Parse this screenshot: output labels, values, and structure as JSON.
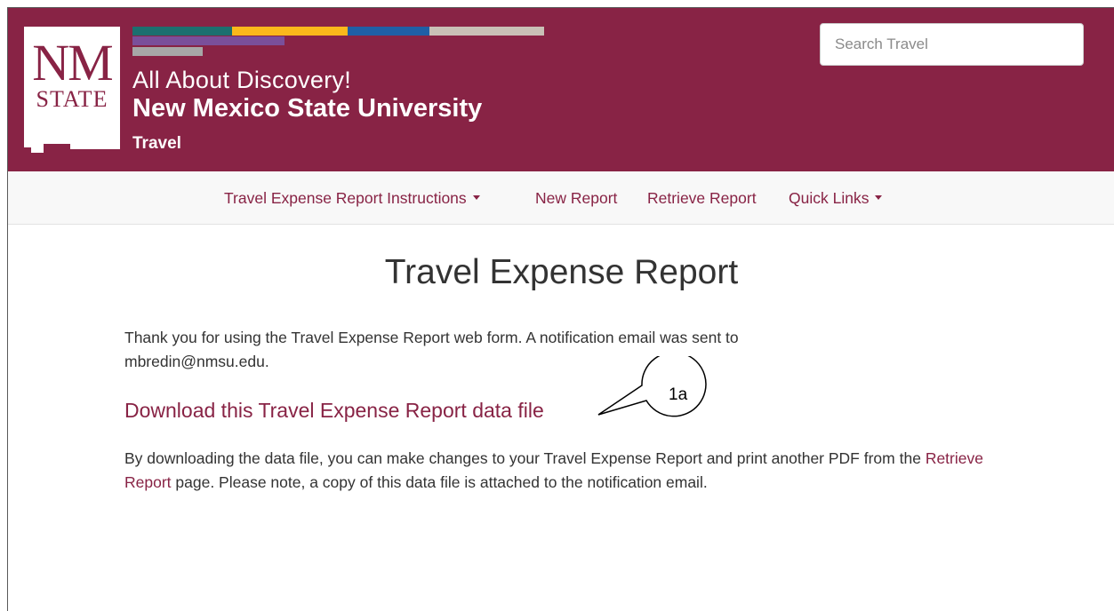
{
  "header": {
    "logo_text": "NM STATE",
    "tagline": "All About Discovery!",
    "university": "New Mexico State University",
    "site": "Travel",
    "brand_color": "#882345",
    "stripe_colors": [
      "#1c6f6f",
      "#fbb81b",
      "#1f5fa6",
      "#c9c0b6",
      "#7a4f9a",
      "#a7a7a7"
    ]
  },
  "search": {
    "placeholder": "Search Travel"
  },
  "nav": {
    "items": [
      {
        "label": "Travel Expense Report Instructions",
        "has_dropdown": true
      },
      {
        "label": "New Report",
        "has_dropdown": false
      },
      {
        "label": "Retrieve Report",
        "has_dropdown": false
      },
      {
        "label": "Quick Links",
        "has_dropdown": true
      }
    ]
  },
  "main": {
    "title": "Travel Expense Report",
    "thanks_text": "Thank you for using the Travel Expense Report web form. A notification email was sent to",
    "email": "mbredin@nmsu.edu",
    "email_suffix": ".",
    "download_link": "Download this Travel Expense Report data file",
    "note_prefix": "By downloading the data file, you can make changes to your Travel Expense Report and print another PDF from the",
    "note_link": "Retrieve Report",
    "note_suffix": "page. Please note, a copy of this data file is attached to the notification email."
  },
  "annotation": {
    "label": "1a"
  }
}
